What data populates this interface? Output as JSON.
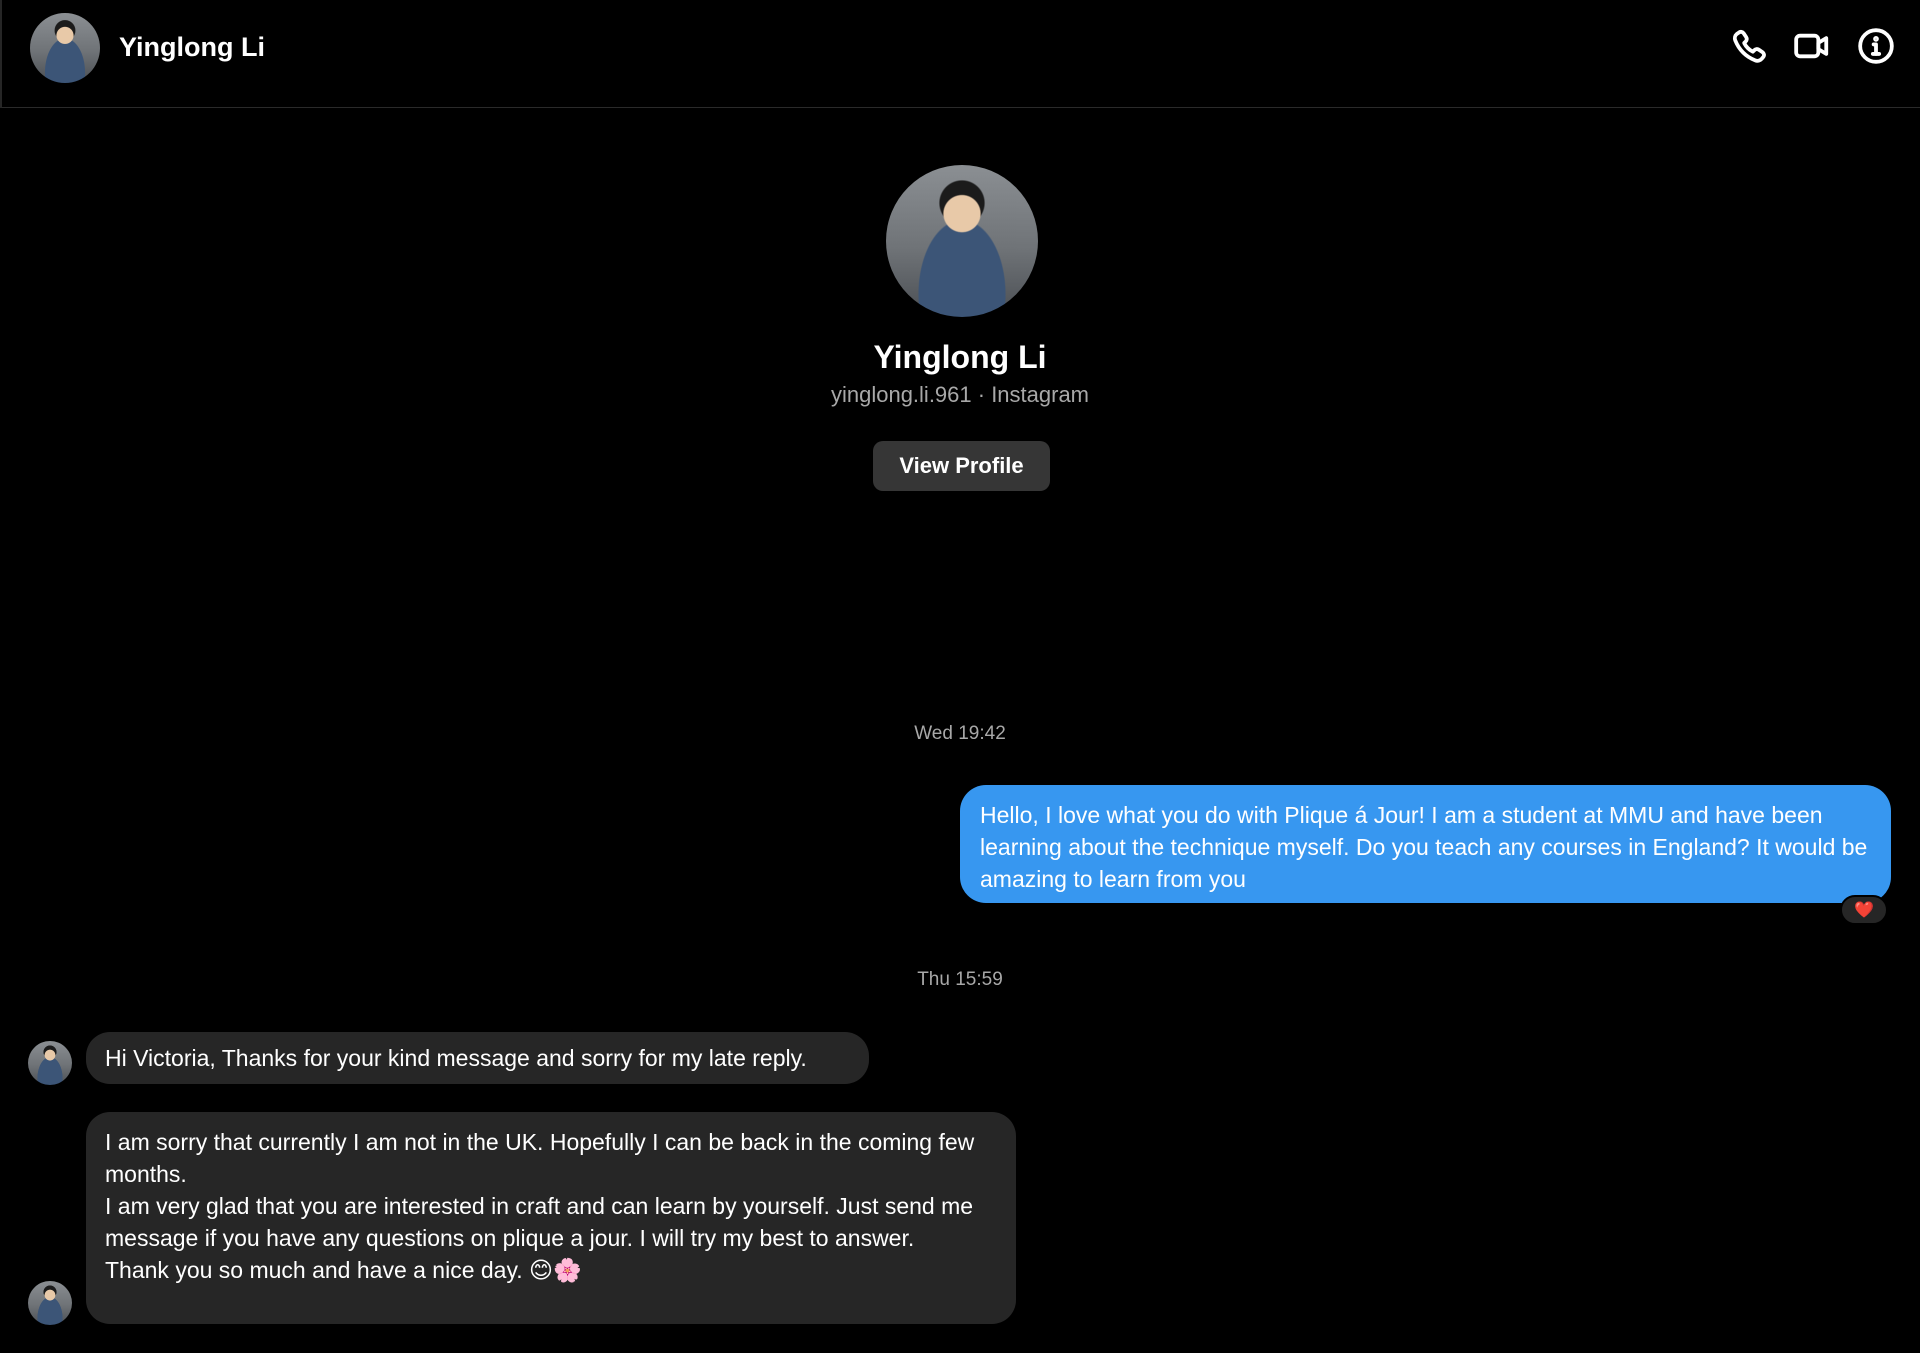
{
  "header": {
    "name": "Yinglong Li",
    "icons": [
      "phone-icon",
      "video-camera-icon",
      "info-icon"
    ]
  },
  "profile": {
    "name": "Yinglong Li",
    "subtitle": "yinglong.li.961 · Instagram",
    "view_profile_label": "View Profile"
  },
  "messages": {
    "timestamp_1": "Wed 19:42",
    "outgoing_1": "Hello, I love what you do with Plique á Jour! I am a student at MMU and have been learning about the technique myself. Do you teach any courses in England? It would be amazing to learn from you",
    "reaction_1": "❤️",
    "timestamp_2": "Thu 15:59",
    "incoming_1": "Hi Victoria, Thanks for your kind message and sorry for my late reply.",
    "incoming_2_line1": "I am sorry that currently I am not in the UK. Hopefully I can be back in the coming few months.",
    "incoming_2_line2": "I am very glad that you are interested in craft and can learn by yourself. Just send me message if you have any questions on plique a jour. I will try my best to answer.",
    "incoming_2_line3": "Thank you so much and have a nice day. 😊🌸"
  },
  "colors": {
    "background": "#000000",
    "outgoing_bubble": "#3797f0",
    "incoming_bubble": "#262626",
    "button": "#363636",
    "muted_text": "#a8a8a8"
  }
}
